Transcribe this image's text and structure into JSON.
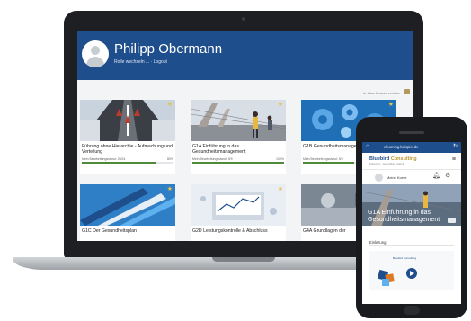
{
  "header": {
    "name": "Philipp Obermann",
    "links": "Rolle wechseln ... · Logout"
  },
  "search_link": "In allen Kursen suchen",
  "courses": [
    {
      "title": "Führung ohne Hierarchie - Aufmachung und Verteilung",
      "progress_text": "Mein Bearbeitungsstand: 20/24",
      "pct_text": "80%",
      "progress": 0.8
    },
    {
      "title": "G1A Einführung in das Gesundheitsmanagement",
      "progress_text": "Mein Bearbeitungsstand: 9/9",
      "pct_text": "100%",
      "progress": 1.0
    },
    {
      "title": "G1B Gesundheitsmanagement als Prozess",
      "progress_text": "Mein Bearbeitungsstand: 5/9",
      "pct_text": "56%",
      "progress": 0.56
    },
    {
      "title": "G1C Der Gesundheitsplan",
      "progress_text": "",
      "pct_text": "",
      "progress": 0
    },
    {
      "title": "G2D Leistungskontrolle & Abschluss",
      "progress_text": "",
      "pct_text": "",
      "progress": 0
    },
    {
      "title": "G4A Grundlagen der",
      "progress_text": "",
      "pct_text": "",
      "progress": 0
    }
  ],
  "phone": {
    "url": "elearning.beispiel.de",
    "logo_part1": "Bluebird",
    "logo_part2": "Consulting",
    "tagline": "Prävention · Gesundheit · Zukunft",
    "my_courses": "Meine Kurse",
    "hero_title": "G1A Einführung in das Gesundheitsmanagement",
    "section_title": "Einleitung",
    "video_logo": "Bluebird Consulting"
  },
  "colors": {
    "header_blue": "#1f4e8c",
    "progress_green": "#4e8a3a",
    "accent_gold": "#b8942e"
  }
}
